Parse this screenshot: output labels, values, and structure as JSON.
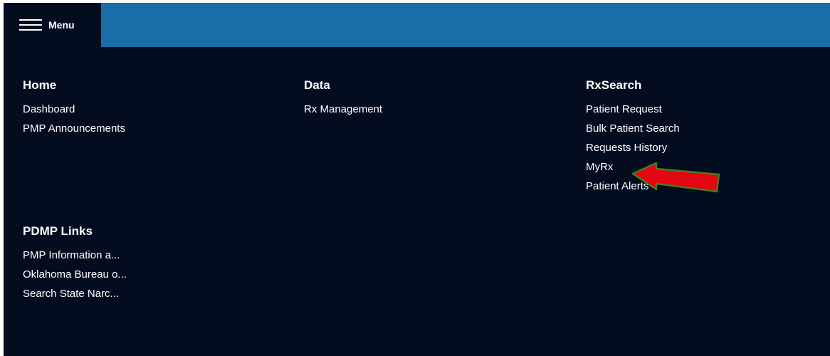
{
  "topbar": {
    "menu_label": "Menu",
    "accent_color": "#1a6ea8",
    "panel_color": "#040d1f"
  },
  "icons": {
    "menu": "hamburger-icon"
  },
  "sections": {
    "home": {
      "title": "Home",
      "items": [
        "Dashboard",
        "PMP Announcements"
      ]
    },
    "data": {
      "title": "Data",
      "items": [
        "Rx Management"
      ]
    },
    "rxsearch": {
      "title": "RxSearch",
      "items": [
        "Patient Request",
        "Bulk Patient Search",
        "Requests History",
        "MyRx",
        "Patient Alerts"
      ]
    },
    "pdmp": {
      "title": "PDMP Links",
      "items": [
        "PMP Information a...",
        "Oklahoma Bureau o...",
        "Search State Narc..."
      ]
    }
  },
  "annotation": {
    "type": "red-arrow",
    "target": "MyRx",
    "color": "#e30613",
    "outline_color": "#4a7a1e"
  }
}
